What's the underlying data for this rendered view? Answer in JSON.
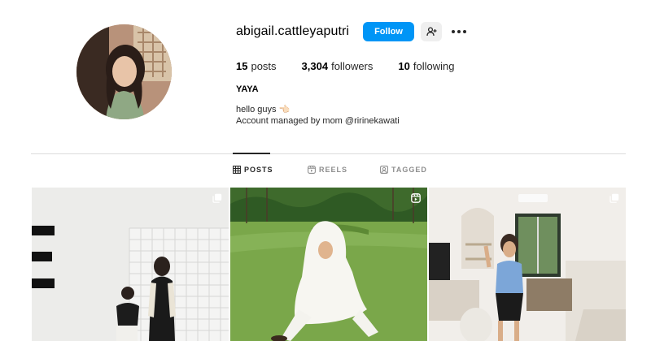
{
  "profile": {
    "username": "abigail.cattleyaputri",
    "follow_label": "Follow",
    "add_user_icon": "add-person-icon",
    "more_icon": "more-options-icon",
    "avatar_icon": "profile-avatar"
  },
  "stats": {
    "posts_count": "15",
    "posts_label": "posts",
    "followers_count": "3,304",
    "followers_label": "followers",
    "following_count": "10",
    "following_label": "following"
  },
  "bio": {
    "full_name": "YAYA",
    "line1": "hello guys 👈🏻",
    "line2": "Account managed by mom @ririnekawati"
  },
  "tabs": [
    {
      "label": "POSTS",
      "icon": "grid-icon",
      "active": true
    },
    {
      "label": "REELS",
      "icon": "reels-icon",
      "active": false
    },
    {
      "label": "TAGGED",
      "icon": "tagged-icon",
      "active": false
    }
  ],
  "posts": [
    {
      "type": "carousel",
      "badge_icon": "multiple-posts-icon"
    },
    {
      "type": "reel",
      "badge_icon": "reel-icon"
    },
    {
      "type": "carousel",
      "badge_icon": "multiple-posts-icon"
    }
  ],
  "colors": {
    "accent": "#0095f6",
    "secondary_button": "#efefef",
    "divider": "#dbdbdb",
    "muted_text": "#8e8e8e"
  }
}
